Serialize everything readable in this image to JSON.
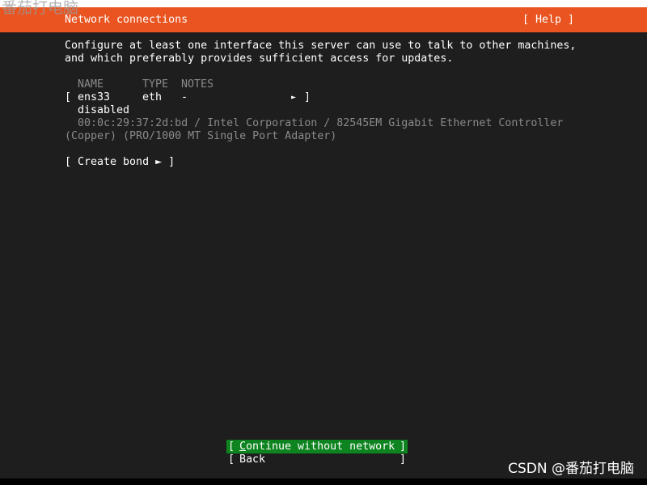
{
  "watermark": {
    "top_text": "番茄打电脑",
    "bottom_text": "CSDN @番茄打电脑"
  },
  "colors": {
    "header_bg": "#e95420",
    "focus_bg": "#0e8420",
    "screen_bg": "#1e1e1e"
  },
  "header": {
    "title": "Network connections",
    "help": "[ Help ]"
  },
  "intro": {
    "line1": "Configure at least one interface this server can use to talk to other machines,",
    "line2": "and which preferably provides sufficient access for updates."
  },
  "table": {
    "headers": {
      "name": "NAME",
      "type": "TYPE",
      "notes": "NOTES"
    },
    "interface": {
      "open_bracket": "[",
      "name": "ens33",
      "type": "eth",
      "notes": "-",
      "arrow": "►",
      "close_bracket": "]",
      "status": "disabled",
      "detail1": "00:0c:29:37:2d:bd / Intel Corporation / 82545EM Gigabit Ethernet Controller",
      "detail2": "(Copper) (PRO/1000 MT Single Port Adapter)"
    }
  },
  "create_bond": {
    "label": "[ Create bond ► ]"
  },
  "buttons": {
    "continue": {
      "open": "[",
      "first": "C",
      "rest": "ontinue without network",
      "close": "]"
    },
    "back": {
      "open": "[",
      "label": "Back",
      "close": "]"
    }
  }
}
